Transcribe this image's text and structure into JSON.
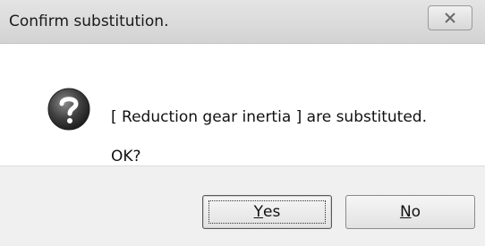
{
  "window": {
    "title": "Confirm substitution."
  },
  "message": {
    "line1": "[ Reduction gear inertia ] are substituted.",
    "line2": "OK?"
  },
  "icons": {
    "title_close": "close-icon",
    "message_icon": "question-icon"
  },
  "buttons": {
    "yes": {
      "mnemonic": "Y",
      "rest": "es"
    },
    "no": {
      "mnemonic": "N",
      "rest": "o"
    }
  },
  "colors": {
    "titlebar": "#d8d8d8",
    "footer": "#f0f0f0",
    "icon": "#3a3a3a"
  }
}
